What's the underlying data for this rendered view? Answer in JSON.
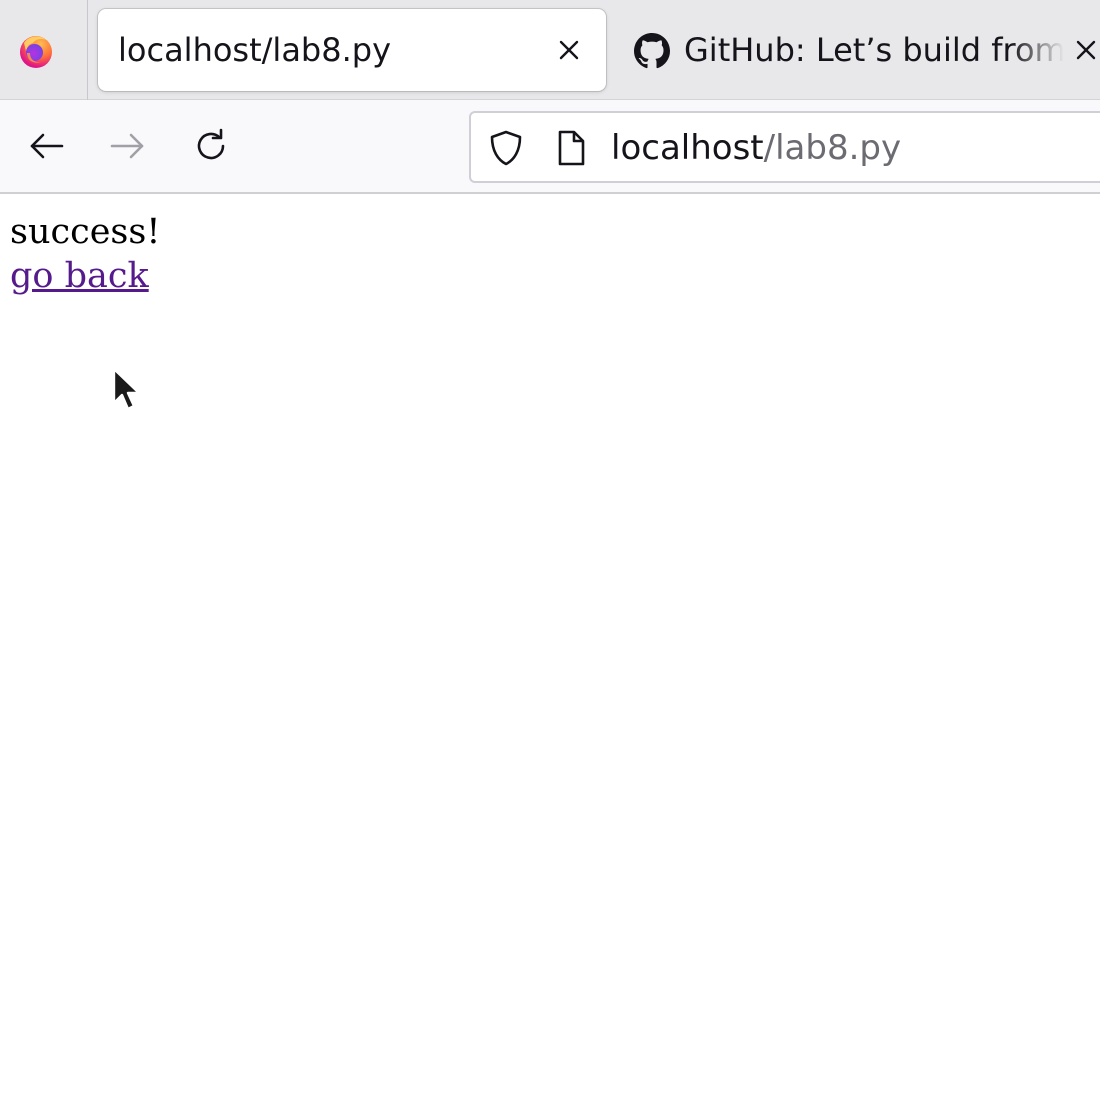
{
  "browser": {
    "name": "Firefox",
    "tabs": [
      {
        "title": "localhost/lab8.py",
        "active": true,
        "icon": "page-icon"
      },
      {
        "title": "GitHub: Let’s build from here",
        "active": false,
        "icon": "github-icon"
      }
    ],
    "close_glyph": "×",
    "address_bar": {
      "host": "localhost",
      "path": "/lab8.py"
    }
  },
  "page": {
    "message": "success!",
    "link_text": "go back",
    "link_color": "#551a8b"
  }
}
